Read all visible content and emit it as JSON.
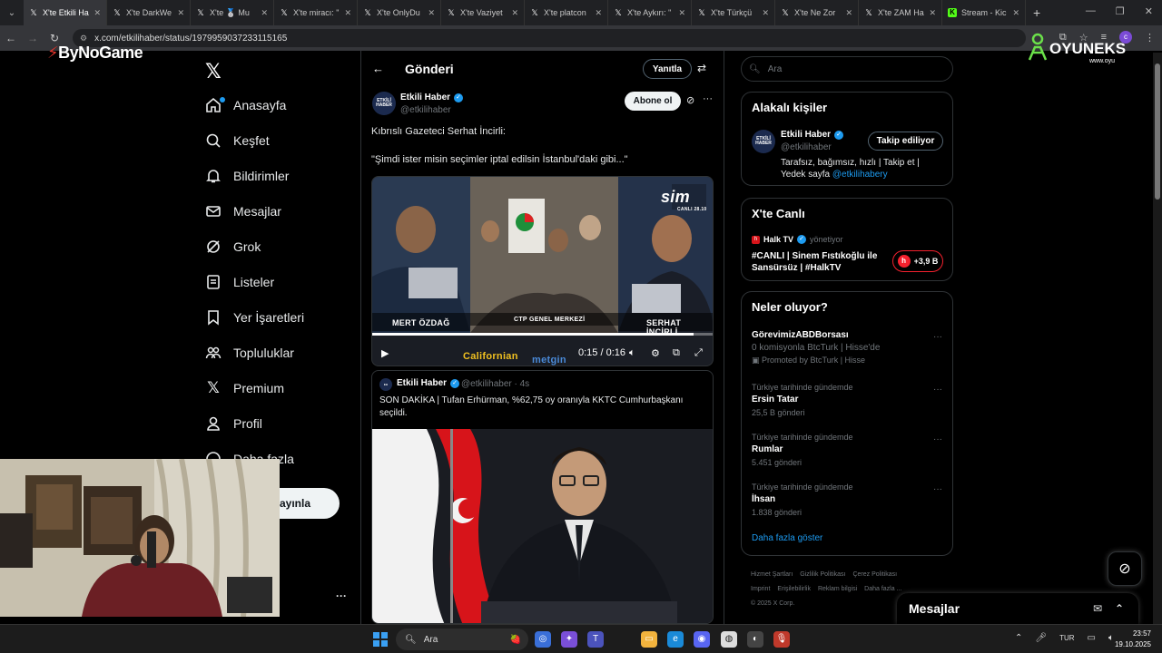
{
  "browser": {
    "tabs": [
      {
        "title": "X'te Etkili Ha",
        "active": true
      },
      {
        "title": "X'te DarkWe"
      },
      {
        "title": "X'te 🥈 Mu"
      },
      {
        "title": "X'te miracı: \""
      },
      {
        "title": "X'te OnlyDu"
      },
      {
        "title": "X'te Vaziyet"
      },
      {
        "title": "X'te platcon"
      },
      {
        "title": "X'te Aykırı: \""
      },
      {
        "title": "X'te Türkçü"
      },
      {
        "title": "X'te Ne Zor"
      },
      {
        "title": "X'te ZAM Ha"
      },
      {
        "title": "Stream - Kic",
        "favicon": "K"
      }
    ],
    "url": "x.com/etkilihaber/status/1979959037233115165",
    "profile_initial": "c"
  },
  "overlays": {
    "bynogame": "ByNoGame",
    "oyuneks_brand": "OYUNEKS",
    "oyuneks_sub": "www.oyu"
  },
  "nav": {
    "items": [
      {
        "label": "Anasayfa",
        "icon": "home-icon"
      },
      {
        "label": "Keşfet",
        "icon": "search-icon"
      },
      {
        "label": "Bildirimler",
        "icon": "bell-icon"
      },
      {
        "label": "Mesajlar",
        "icon": "mail-icon"
      },
      {
        "label": "Grok",
        "icon": "grok-icon"
      },
      {
        "label": "Listeler",
        "icon": "list-icon"
      },
      {
        "label": "Yer İşaretleri",
        "icon": "bookmark-icon"
      },
      {
        "label": "Topluluklar",
        "icon": "community-icon"
      },
      {
        "label": "Premium",
        "icon": "x-icon"
      },
      {
        "label": "Profil",
        "icon": "person-icon"
      },
      {
        "label": "Daha fazla",
        "icon": "more-circle-icon"
      }
    ],
    "post_button": "ayınla"
  },
  "post": {
    "header_title": "Gönderi",
    "reply_button": "Yanıtla",
    "author_name": "Etkili Haber",
    "author_handle": "@etkilihaber",
    "avatar_text": "ETKİLİ HABER",
    "subscribe_button": "Abone ol",
    "text_line1": "Kıbrıslı Gazeteci Serhat İncirli:",
    "text_line2": "\"Şimdi ister misin seçimler iptal edilsin İstanbul'daki gibi...\"",
    "video": {
      "label_left": "MERT ÖZDAĞ",
      "label_center": "CTP GENEL MERKEZİ",
      "label_right": "SERHAT İNCİRLİ",
      "channel_logo": "sim",
      "channel_sub": "CANLI 28.10",
      "sponsor1": "Californian",
      "sponsor2": "metgin",
      "time": "0:15 / 0:16",
      "progress": 0.94
    },
    "quote": {
      "author_name": "Etkili Haber",
      "author_handle": "@etkilihaber · 4s",
      "text": "SON DAKİKA | Tufan Erhürman, %62,75 oy oranıyla KKTC Cumhurbaşkanı seçildi."
    }
  },
  "sidebar": {
    "search_placeholder": "Ara",
    "related": {
      "title": "Alakalı kişiler",
      "name": "Etkili Haber",
      "handle": "@etkilihaber",
      "follow_button": "Takip ediliyor",
      "bio_text": "Tarafsız, bağımsız, hızlı | Takip et | Yedek sayfa",
      "bio_link": "@etkilihabery"
    },
    "live": {
      "title": "X'te Canlı",
      "host": "Halk TV",
      "host_suffix": "yönetiyor",
      "text": "#CANLI | Sinem Fıstıkoğlu ile Sansürsüz | #HalkTV",
      "listeners": "+3,9 B"
    },
    "trends": {
      "title": "Neler oluyor?",
      "items": [
        {
          "name": "GörevimizABDBorsası",
          "line2": "0 komisyonla BtcTurk | Hisse'de",
          "line3": "Promoted by BtcTurk | Hisse",
          "promoted": true
        },
        {
          "ctx": "Türkiye tarihinde gündemde",
          "name": "Ersin Tatar",
          "cnt": "25,5 B gönderi"
        },
        {
          "ctx": "Türkiye tarihinde gündemde",
          "name": "Rumlar",
          "cnt": "5.451 gönderi"
        },
        {
          "ctx": "Türkiye tarihinde gündemde",
          "name": "İhsan",
          "cnt": "1.838 gönderi"
        }
      ],
      "show_more": "Daha fazla göster"
    },
    "footer": [
      "Hizmet Şartları",
      "Gizlilik Politikası",
      "Çerez Politikası",
      "Imprint",
      "Erişilebilirlik",
      "Reklam bilgisi",
      "Daha fazla ...",
      "© 2025 X Corp."
    ]
  },
  "messages_panel": {
    "title": "Mesajlar"
  },
  "taskbar": {
    "search": "Ara",
    "lang": "TUR",
    "time": "23:57",
    "date": "19.10.2025"
  },
  "colors": {
    "accent": "#1d9bf0",
    "background": "#000000",
    "border": "#2f3336",
    "live": "#f4212e"
  }
}
